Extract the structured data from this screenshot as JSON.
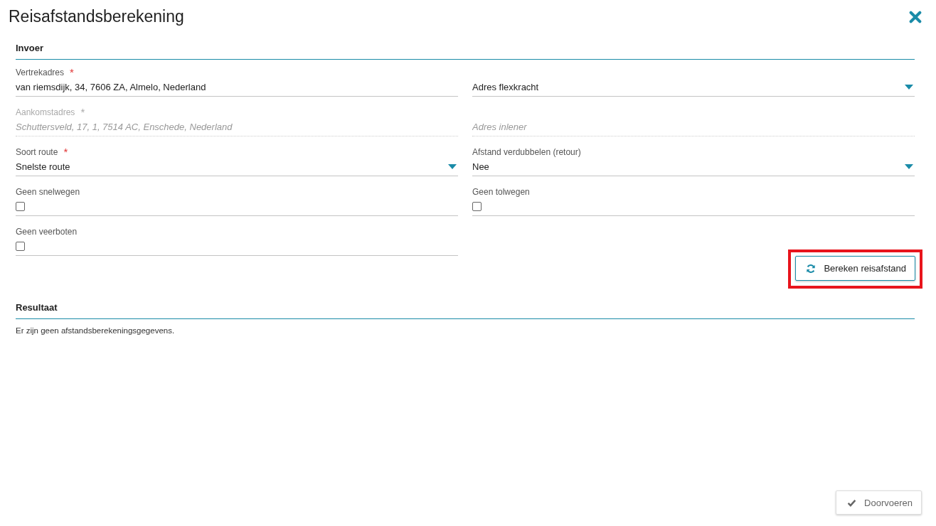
{
  "window": {
    "title": "Reisafstandsberekening"
  },
  "input_section": {
    "heading": "Invoer",
    "fields": [
      {
        "kind": "text",
        "label": "Vertrekadres",
        "required_mark": "*",
        "value": "van riemsdijk, 34, 7606 ZA, Almelo, Nederland",
        "disabled": false
      },
      {
        "kind": "select",
        "value": "Adres flexkracht",
        "disabled": false
      },
      {
        "kind": "text",
        "label": "Aankomstadres",
        "required_mark": "*",
        "value": "Schuttersveld, 17, 1, 7514 AC, Enschede, Nederland",
        "disabled": true
      },
      {
        "kind": "text",
        "placeholder": "Adres inlener",
        "disabled": true
      },
      {
        "kind": "select",
        "label": "Soort route",
        "required_mark": "*",
        "value": "Snelste route",
        "disabled": false
      },
      {
        "kind": "select",
        "label": "Afstand verdubbelen (retour)",
        "value": "Nee",
        "disabled": false
      },
      {
        "kind": "checkbox",
        "label": "Geen snelwegen",
        "checked": false
      },
      {
        "kind": "checkbox",
        "label": "Geen tolwegen",
        "checked": false
      },
      {
        "kind": "checkbox",
        "label": "Geen veerboten",
        "checked": false
      }
    ],
    "calculate_button": {
      "label": "Bereken reisafstand",
      "highlighted": true
    }
  },
  "result_section": {
    "heading": "Resultaat",
    "message": "Er zijn geen afstandsberekeningsgegevens."
  },
  "footer": {
    "submit_button": {
      "label": "Doorvoeren"
    }
  }
}
